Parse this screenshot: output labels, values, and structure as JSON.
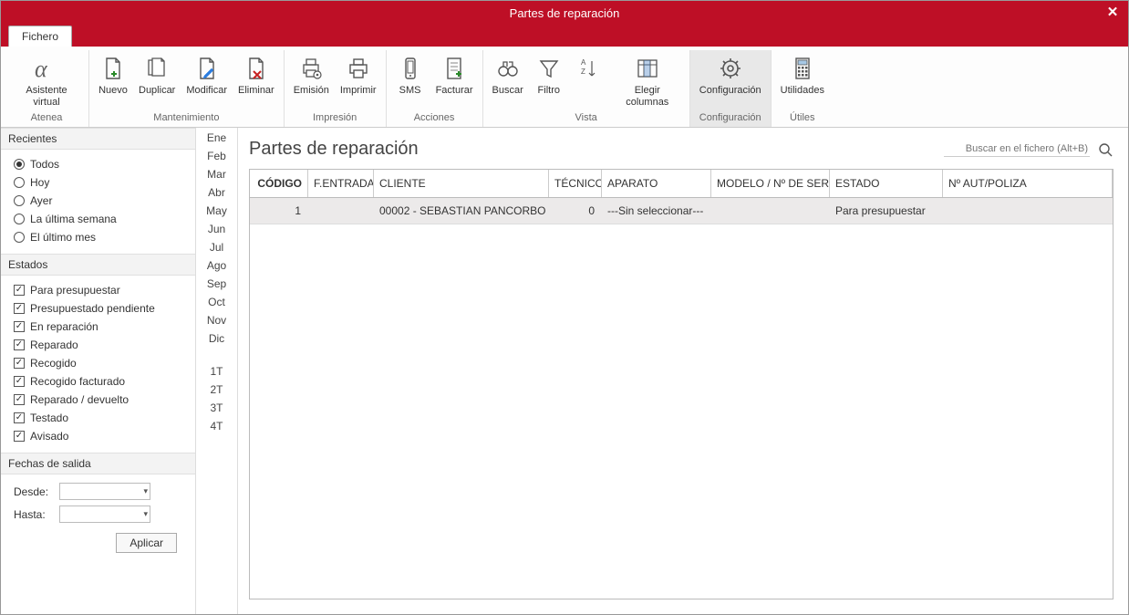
{
  "window_title": "Partes de reparación",
  "tab_label": "Fichero",
  "ribbon": {
    "groups": [
      {
        "label": "Atenea",
        "buttons": [
          {
            "label": "Asistente virtual"
          }
        ]
      },
      {
        "label": "Mantenimiento",
        "buttons": [
          {
            "label": "Nuevo"
          },
          {
            "label": "Duplicar"
          },
          {
            "label": "Modificar"
          },
          {
            "label": "Eliminar"
          }
        ]
      },
      {
        "label": "Impresión",
        "buttons": [
          {
            "label": "Emisión"
          },
          {
            "label": "Imprimir"
          }
        ]
      },
      {
        "label": "Acciones",
        "buttons": [
          {
            "label": "SMS"
          },
          {
            "label": "Facturar"
          }
        ]
      },
      {
        "label": "Vista",
        "buttons": [
          {
            "label": "Buscar"
          },
          {
            "label": "Filtro"
          },
          {
            "label": " "
          },
          {
            "label": "Elegir columnas"
          }
        ]
      },
      {
        "label": "Configuración",
        "selected": true,
        "buttons": [
          {
            "label": "Configuración"
          }
        ]
      },
      {
        "label": "Útiles",
        "buttons": [
          {
            "label": "Utilidades"
          }
        ]
      }
    ]
  },
  "sidebar": {
    "recientes": {
      "title": "Recientes",
      "options": [
        {
          "label": "Todos",
          "checked": true
        },
        {
          "label": "Hoy",
          "checked": false
        },
        {
          "label": "Ayer",
          "checked": false
        },
        {
          "label": "La última semana",
          "checked": false
        },
        {
          "label": "El último mes",
          "checked": false
        }
      ]
    },
    "estados": {
      "title": "Estados",
      "options": [
        {
          "label": "Para presupuestar",
          "checked": true
        },
        {
          "label": "Presupuestado pendiente",
          "checked": true
        },
        {
          "label": "En reparación",
          "checked": true
        },
        {
          "label": "Reparado",
          "checked": true
        },
        {
          "label": "Recogido",
          "checked": true
        },
        {
          "label": "Recogido facturado",
          "checked": true
        },
        {
          "label": "Reparado / devuelto",
          "checked": true
        },
        {
          "label": "Testado",
          "checked": true
        },
        {
          "label": "Avisado",
          "checked": true
        }
      ]
    },
    "fechas": {
      "title": "Fechas de salida",
      "desde": "Desde:",
      "hasta": "Hasta:",
      "aplicar": "Aplicar"
    }
  },
  "months": [
    "Ene",
    "Feb",
    "Mar",
    "Abr",
    "May",
    "Jun",
    "Jul",
    "Ago",
    "Sep",
    "Oct",
    "Nov",
    "Dic"
  ],
  "quarters": [
    "1T",
    "2T",
    "3T",
    "4T"
  ],
  "main": {
    "title": "Partes de reparación",
    "search_placeholder": "Buscar en el fichero (Alt+B)"
  },
  "grid": {
    "columns": {
      "codigo": "CÓDIGO",
      "fentrada": "F.ENTRADA",
      "cliente": "CLIENTE",
      "tecnico": "TÉCNICO",
      "aparato": "APARATO",
      "modelo": "MODELO / Nº DE SERIE:",
      "estado": "ESTADO",
      "poliza": "Nº AUT/POLIZA"
    },
    "rows": [
      {
        "codigo": "1",
        "fentrada": "",
        "cliente": "00002 - SEBASTIAN PANCORBO",
        "tecnico": "0",
        "aparato": "---Sin seleccionar---",
        "modelo": "",
        "estado": "Para presupuestar",
        "poliza": ""
      }
    ]
  }
}
